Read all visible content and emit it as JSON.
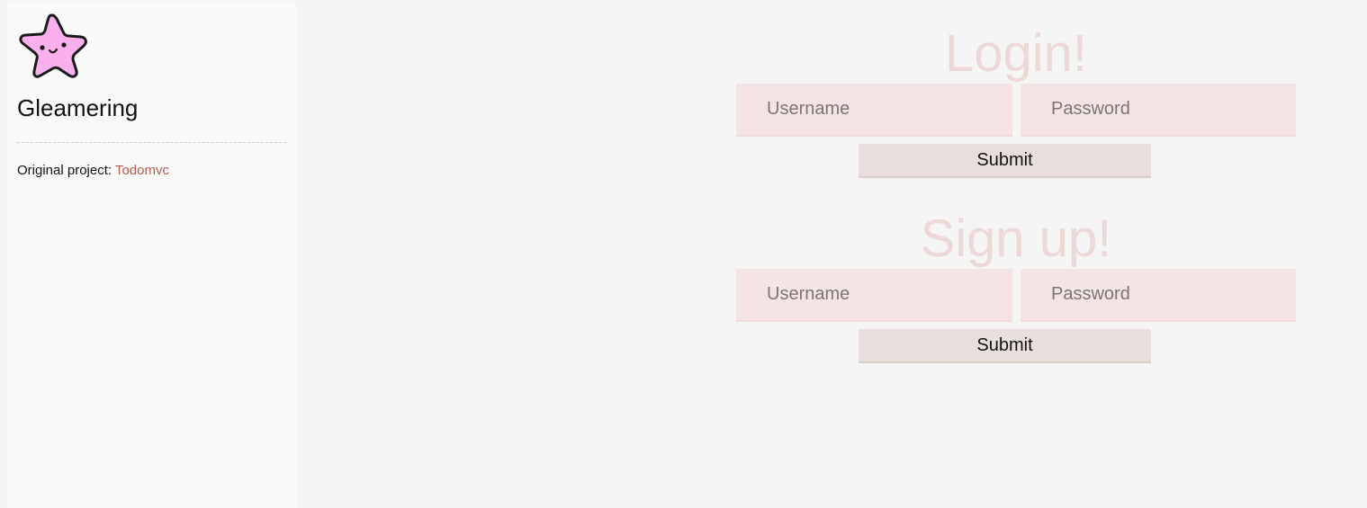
{
  "sidebar": {
    "app_name": "Gleamering",
    "project_label": "Original project: ",
    "project_link": "Todomvc"
  },
  "login": {
    "title": "Login!",
    "username_placeholder": "Username",
    "password_placeholder": "Password",
    "submit_label": "Submit"
  },
  "signup": {
    "title": "Sign up!",
    "username_placeholder": "Username",
    "password_placeholder": "Password",
    "submit_label": "Submit"
  },
  "colors": {
    "background": "#f5f5f5",
    "sidebar": "#fafafa",
    "title": "#ecd8d7",
    "field": "#f5e4e4",
    "button": "#e8dfdd",
    "link": "#b35a4e",
    "logo_star": "#f9b0ed"
  },
  "icons": {
    "logo": "star-mascot-icon"
  }
}
